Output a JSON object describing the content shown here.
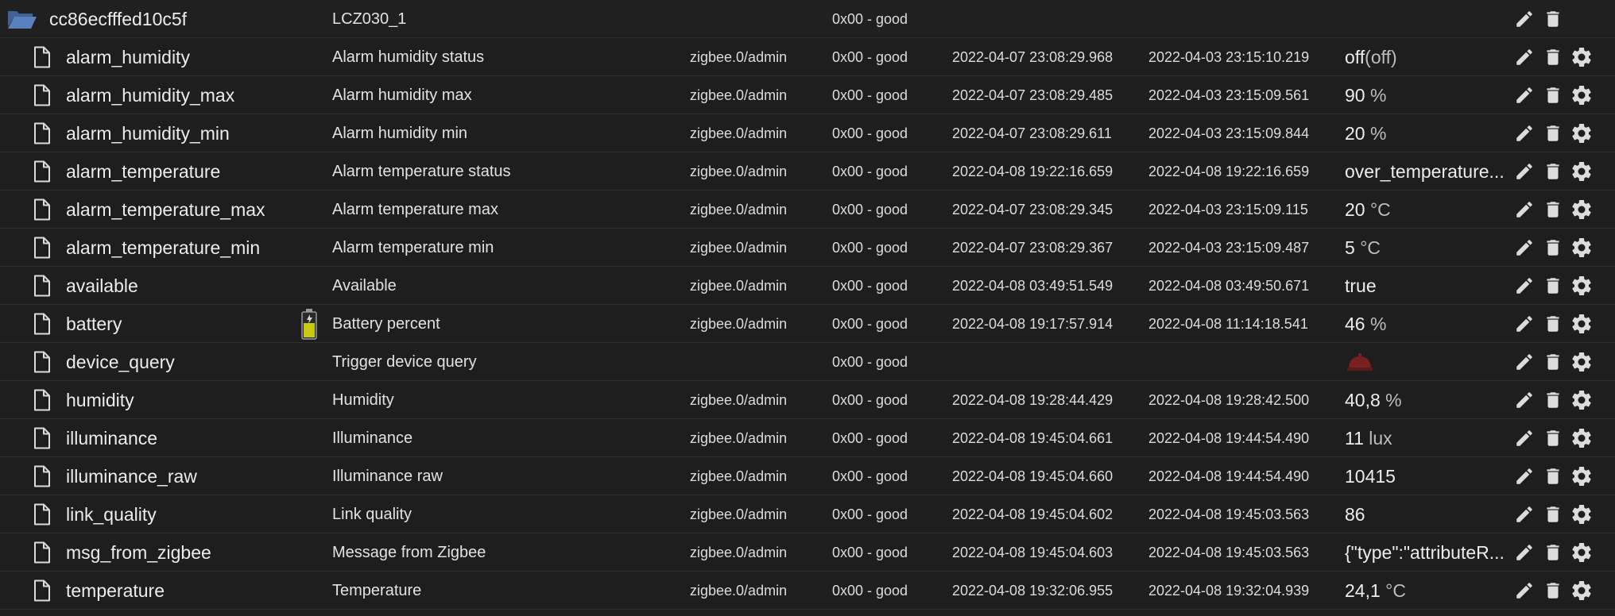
{
  "device": {
    "id": "cc86ecfffed10c5f",
    "name": "LCZ030_1",
    "quality": "0x00 - good"
  },
  "states": [
    {
      "id": "alarm_humidity",
      "name": "Alarm humidity status",
      "from": "zigbee.0/admin",
      "quality": "0x00 - good",
      "ts": "2022-04-07 23:08:29.968",
      "lc": "2022-04-03 23:15:10.219",
      "value": "off",
      "unit": "(off)",
      "valueType": "text"
    },
    {
      "id": "alarm_humidity_max",
      "name": "Alarm humidity max",
      "from": "zigbee.0/admin",
      "quality": "0x00 - good",
      "ts": "2022-04-07 23:08:29.485",
      "lc": "2022-04-03 23:15:09.561",
      "value": "90",
      "unit": "%",
      "valueType": "text"
    },
    {
      "id": "alarm_humidity_min",
      "name": "Alarm humidity min",
      "from": "zigbee.0/admin",
      "quality": "0x00 - good",
      "ts": "2022-04-07 23:08:29.611",
      "lc": "2022-04-03 23:15:09.844",
      "value": "20",
      "unit": "%",
      "valueType": "text"
    },
    {
      "id": "alarm_temperature",
      "name": "Alarm temperature status",
      "from": "zigbee.0/admin",
      "quality": "0x00 - good",
      "ts": "2022-04-08 19:22:16.659",
      "lc": "2022-04-08 19:22:16.659",
      "value": "over_temperature...",
      "unit": "",
      "valueType": "text"
    },
    {
      "id": "alarm_temperature_max",
      "name": "Alarm temperature max",
      "from": "zigbee.0/admin",
      "quality": "0x00 - good",
      "ts": "2022-04-07 23:08:29.345",
      "lc": "2022-04-03 23:15:09.115",
      "value": "20",
      "unit": "°C",
      "valueType": "text"
    },
    {
      "id": "alarm_temperature_min",
      "name": "Alarm temperature min",
      "from": "zigbee.0/admin",
      "quality": "0x00 - good",
      "ts": "2022-04-07 23:08:29.367",
      "lc": "2022-04-03 23:15:09.487",
      "value": "5",
      "unit": "°C",
      "valueType": "text"
    },
    {
      "id": "available",
      "name": "Available",
      "from": "zigbee.0/admin",
      "quality": "0x00 - good",
      "ts": "2022-04-08 03:49:51.549",
      "lc": "2022-04-08 03:49:50.671",
      "value": "true",
      "unit": "",
      "valueType": "text"
    },
    {
      "id": "battery",
      "name": "Battery percent",
      "from": "zigbee.0/admin",
      "quality": "0x00 - good",
      "ts": "2022-04-08 19:17:57.914",
      "lc": "2022-04-08 11:14:18.541",
      "value": "46",
      "unit": "%",
      "valueType": "text",
      "roleIcon": "battery-icon"
    },
    {
      "id": "device_query",
      "name": "Trigger device query",
      "from": "",
      "quality": "0x00 - good",
      "ts": "",
      "lc": "",
      "value": "",
      "unit": "",
      "valueType": "button",
      "valueIcon": "bell-icon"
    },
    {
      "id": "humidity",
      "name": "Humidity",
      "from": "zigbee.0/admin",
      "quality": "0x00 - good",
      "ts": "2022-04-08 19:28:44.429",
      "lc": "2022-04-08 19:28:42.500",
      "value": "40,8",
      "unit": "%",
      "valueType": "text"
    },
    {
      "id": "illuminance",
      "name": "Illuminance",
      "from": "zigbee.0/admin",
      "quality": "0x00 - good",
      "ts": "2022-04-08 19:45:04.661",
      "lc": "2022-04-08 19:44:54.490",
      "value": "11",
      "unit": "lux",
      "valueType": "text"
    },
    {
      "id": "illuminance_raw",
      "name": "Illuminance raw",
      "from": "zigbee.0/admin",
      "quality": "0x00 - good",
      "ts": "2022-04-08 19:45:04.660",
      "lc": "2022-04-08 19:44:54.490",
      "value": "10415",
      "unit": "",
      "valueType": "text"
    },
    {
      "id": "link_quality",
      "name": "Link quality",
      "from": "zigbee.0/admin",
      "quality": "0x00 - good",
      "ts": "2022-04-08 19:45:04.602",
      "lc": "2022-04-08 19:45:03.563",
      "value": "86",
      "unit": "",
      "valueType": "text"
    },
    {
      "id": "msg_from_zigbee",
      "name": "Message from Zigbee",
      "from": "zigbee.0/admin",
      "quality": "0x00 - good",
      "ts": "2022-04-08 19:45:04.603",
      "lc": "2022-04-08 19:45:03.563",
      "value": "{\"type\":\"attributeR...",
      "unit": "",
      "valueType": "text"
    },
    {
      "id": "temperature",
      "name": "Temperature",
      "from": "zigbee.0/admin",
      "quality": "0x00 - good",
      "ts": "2022-04-08 19:32:06.955",
      "lc": "2022-04-08 19:32:04.939",
      "value": "24,1",
      "unit": "°C",
      "valueType": "text"
    }
  ],
  "icons": {
    "folder": "folder-open-icon",
    "file": "file-icon",
    "edit": "pencil-icon",
    "delete": "trash-icon",
    "settings": "gear-icon"
  },
  "colors": {
    "background": "#1e1e1e",
    "text": "#e6e6e6",
    "folder": "#4a6fa5",
    "bell": "#7a2020",
    "battery": "#c9c90e"
  }
}
